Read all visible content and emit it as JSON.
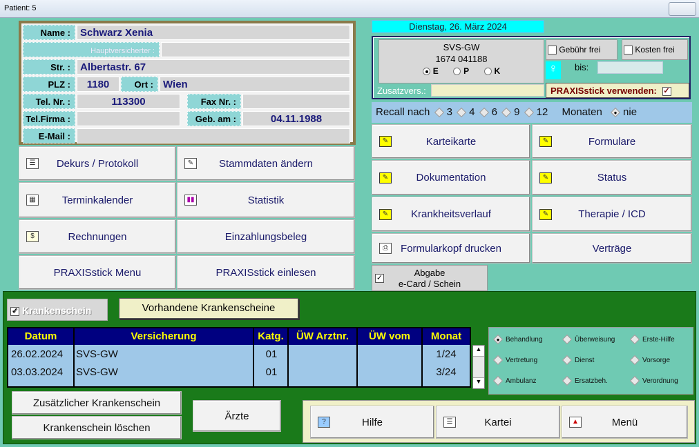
{
  "window": {
    "title": "Patient: 5"
  },
  "patient": {
    "name_label": "Name :",
    "name": "Schwarz Xenia",
    "hauptvers_label": "Hauptversicherter :",
    "hauptvers": "",
    "street_label": "Str. :",
    "street": "Albertastr. 67",
    "plz_label": "PLZ :",
    "plz": "1180",
    "ort_label": "Ort :",
    "ort": "Wien",
    "tel_label": "Tel. Nr. :",
    "tel": "113300",
    "fax_label": "Fax Nr. :",
    "fax": "",
    "telfirma_label": "Tel.Firma :",
    "telfirma": "",
    "geb_label": "Geb. am :",
    "geb": "04.11.1988",
    "email_label": "E-Mail :",
    "email": ""
  },
  "left_buttons": {
    "dekurs": "Dekurs / Protokoll",
    "stammdaten": "Stammdaten ändern",
    "termin": "Terminkalender",
    "statistik": "Statistik",
    "rechnungen": "Rechnungen",
    "einzahlung": "Einzahlungsbeleg",
    "stick_menu": "PRAXISstick Menu",
    "stick_einlesen": "PRAXISstick einlesen"
  },
  "date": "Dienstag, 26. März 2024",
  "insurance": {
    "name": "SVS-GW",
    "number": "1674 041188",
    "opt_e": "E",
    "opt_p": "P",
    "opt_k": "K",
    "selected": "E",
    "gebuehr_label": "Gebühr frei",
    "kosten_label": "Kosten frei",
    "bis_label": "bis:",
    "bis_value": "",
    "zusatz_label": "Zusatzvers.:",
    "zusatz_value": "",
    "stick_label": "PRAXISstick verwenden:",
    "stick_checked": true
  },
  "recall": {
    "label": "Recall nach",
    "options": [
      "3",
      "4",
      "6",
      "9",
      "12"
    ],
    "months_label": "Monaten",
    "never_label": "nie",
    "selected": "nie"
  },
  "right_buttons": {
    "karteikarte": "Karteikarte",
    "formulare": "Formulare",
    "dokumentation": "Dokumentation",
    "status": "Status",
    "krankheitsverlauf": "Krankheitsverlauf",
    "therapie": "Therapie / ICD",
    "formularkopf": "Formularkopf drucken",
    "vertraege": "Verträge",
    "abgabe_line1": "Abgabe",
    "abgabe_line2": "e-Card / Schein"
  },
  "krankenschein": {
    "checkbox_label": "Krankenschein",
    "vorhandene_button": "Vorhandene Krankenscheine",
    "columns": [
      "Datum",
      "Versicherung",
      "Katg.",
      "ÜW Arztnr.",
      "ÜW vom",
      "Monat"
    ],
    "rows": [
      [
        "26.02.2024",
        "SVS-GW",
        "01",
        "",
        "",
        "1/24"
      ],
      [
        "03.03.2024",
        "SVS-GW",
        "01",
        "",
        "",
        "3/24"
      ]
    ],
    "types": [
      "Behandlung",
      "Überweisung",
      "Erste-Hilfe",
      "Vertretung",
      "Dienst",
      "Vorsorge",
      "Ambulanz",
      "Ersatzbeh.",
      "Verordnung"
    ],
    "selected_type": "Behandlung",
    "zusaetzlich_button": "Zusätzlicher Krankenschein",
    "loeschen_button": "Krankenschein löschen",
    "aerzte_button": "Ärzte"
  },
  "bottom": {
    "hilfe": "Hilfe",
    "kartei": "Kartei",
    "menu": "Menü"
  }
}
